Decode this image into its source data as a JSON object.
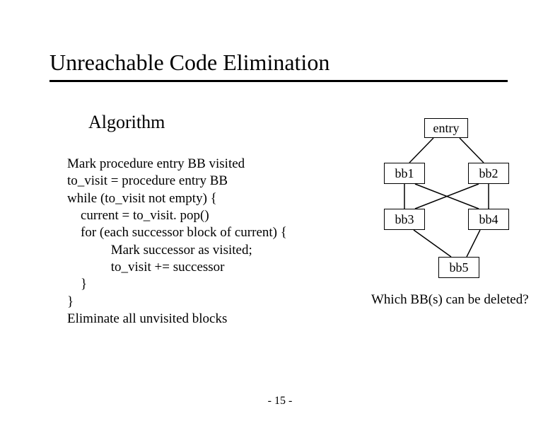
{
  "title": "Unreachable Code Elimination",
  "subtitle": "Algorithm",
  "algorithm": {
    "l1": "Mark procedure entry BB visited",
    "l2": "to_visit = procedure entry BB",
    "l3": "while (to_visit not empty) {",
    "l4": "    current = to_visit. pop()",
    "l5": "    for (each successor block of current) {",
    "l6": "             Mark successor as visited;",
    "l7": "             to_visit += successor",
    "l8": "    }",
    "l9": "}",
    "l10": "Eliminate all unvisited blocks"
  },
  "graph": {
    "entry": "entry",
    "bb1": "bb1",
    "bb2": "bb2",
    "bb3": "bb3",
    "bb4": "bb4",
    "bb5": "bb5"
  },
  "question": "Which BB(s) can be deleted?",
  "pagenum": "- 15 -"
}
